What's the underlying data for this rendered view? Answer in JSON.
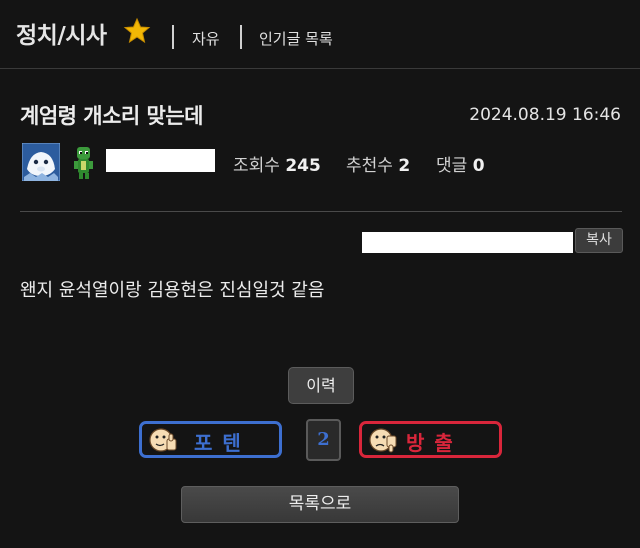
{
  "header": {
    "board_title": "정치/시사",
    "tabs": [
      "자유",
      "인기글 목록"
    ]
  },
  "post": {
    "title": "계엄령 개소리 맞는데",
    "date": "2024.08.19 16:46",
    "stats": {
      "views_label": "조회수",
      "views": "245",
      "recommend_label": "추천수",
      "recommend": "2",
      "comments_label": "댓글",
      "comments": "0"
    },
    "copy_label": "복사",
    "body": "왠지 윤석열이랑 김용현은 진심일것 같음"
  },
  "actions": {
    "history_label": "이력",
    "upvote_label": "포텐",
    "downvote_label": "방출",
    "vote_count": "2",
    "list_label": "목록으로"
  },
  "colors": {
    "background": "#141414",
    "upvote": "#3d6fd0",
    "downvote": "#d9263b"
  }
}
